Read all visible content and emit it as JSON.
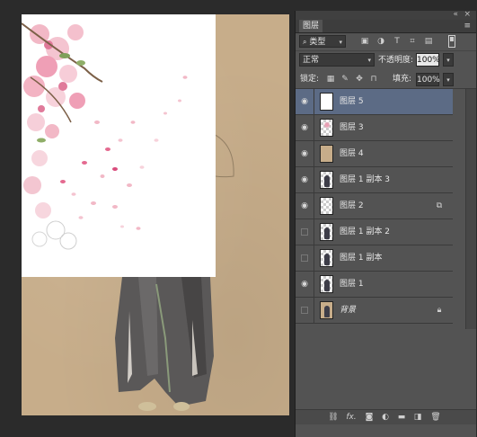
{
  "panel": {
    "tab": "图层",
    "collapse_icon": "double-chevron-icon",
    "close_icon": "close-icon",
    "menu_icon": "panel-menu-icon",
    "filter": {
      "kind_value": "类型",
      "icons": [
        "image-filter-icon",
        "adjustment-filter-icon",
        "text-filter-icon",
        "shape-filter-icon",
        "smart-object-filter-icon"
      ]
    },
    "blend": {
      "mode": "正常",
      "opacity_label": "不透明度:",
      "opacity_value": "100%"
    },
    "lock": {
      "label": "锁定:",
      "icons": [
        "lock-transparency-icon",
        "lock-pixels-icon",
        "lock-position-icon",
        "lock-all-icon"
      ],
      "fill_label": "填充:",
      "fill_value": "100%"
    },
    "layers": [
      {
        "name": "图层 5",
        "visible": true,
        "selected": true,
        "thumb": "white",
        "badge": ""
      },
      {
        "name": "图层 3",
        "visible": true,
        "selected": false,
        "thumb": "checker-flower",
        "badge": ""
      },
      {
        "name": "图层 4",
        "visible": true,
        "selected": false,
        "thumb": "tan",
        "badge": ""
      },
      {
        "name": "图层 1 副本 3",
        "visible": true,
        "selected": false,
        "thumb": "checker-figure",
        "badge": ""
      },
      {
        "name": "图层 2",
        "visible": true,
        "selected": false,
        "thumb": "checker",
        "badge": "linked-layer-icon"
      },
      {
        "name": "图层 1 副本 2",
        "visible": false,
        "selected": false,
        "thumb": "checker-figure",
        "badge": ""
      },
      {
        "name": "图层 1 副本",
        "visible": false,
        "selected": false,
        "thumb": "checker-figure",
        "badge": ""
      },
      {
        "name": "图层 1",
        "visible": true,
        "selected": false,
        "thumb": "checker-figure",
        "badge": ""
      },
      {
        "name": "背景",
        "visible": false,
        "selected": false,
        "thumb": "tan-figure",
        "badge": "lock-icon"
      }
    ],
    "bottom_icons": [
      "link-layers-icon",
      "fx-icon",
      "add-mask-icon",
      "adjustment-layer-icon",
      "new-group-icon",
      "new-layer-icon",
      "delete-icon"
    ],
    "fx_text": "fx."
  },
  "colors": {
    "panel_bg": "#535353",
    "selected_row": "#5c6b85",
    "workspace": "#2b2b2b",
    "paper": "#c7ad8a"
  }
}
